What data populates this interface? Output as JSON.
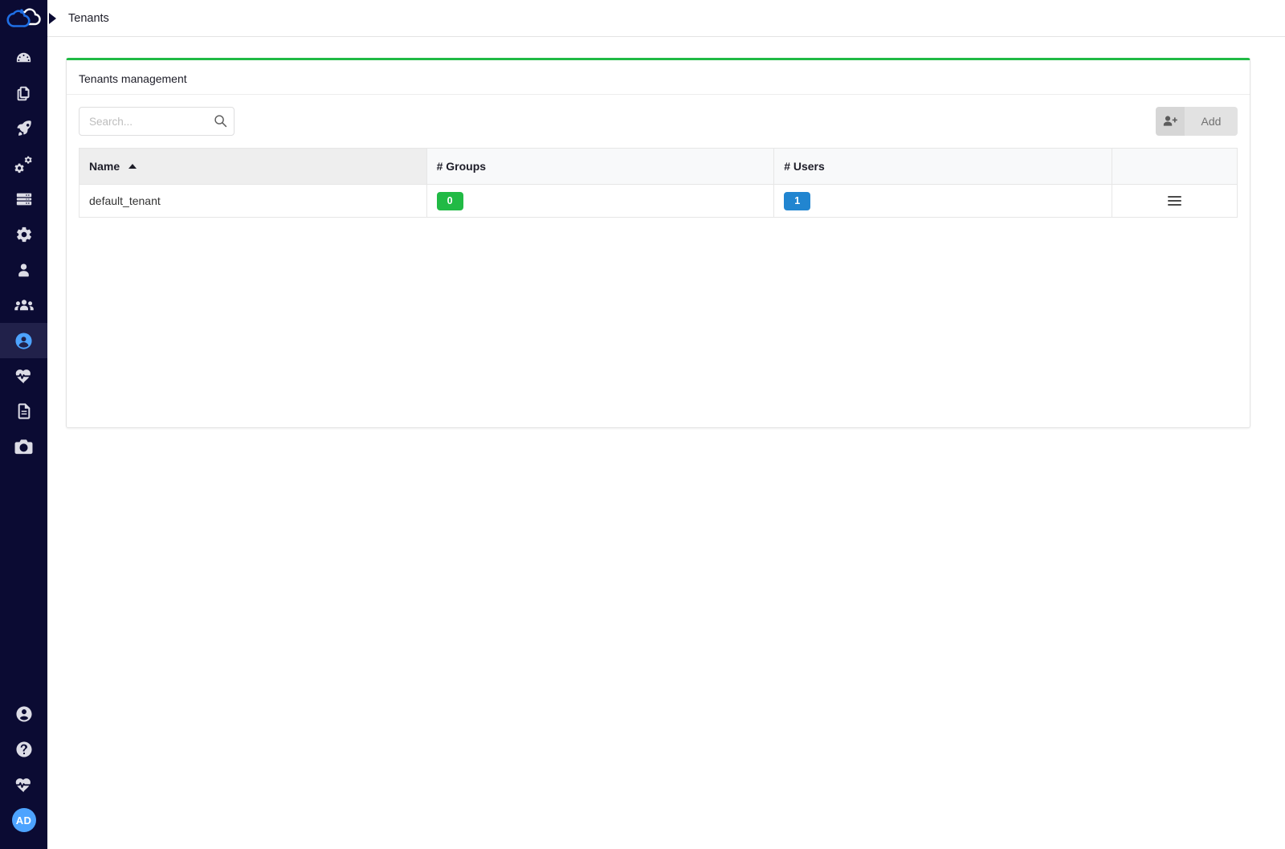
{
  "app": {
    "logo_name": "cloud-logo",
    "accent_green": "#21ba45",
    "accent_blue": "#2185d0",
    "sidebar_bg": "#0b0b33"
  },
  "topbar": {
    "breadcrumb": "Tenants"
  },
  "sidebar": {
    "top_items": [
      {
        "icon": "dashboard-gauge-icon",
        "name": "sidebar-item-dashboard",
        "active": false
      },
      {
        "icon": "blueprints-copy-icon",
        "name": "sidebar-item-blueprints",
        "active": false
      },
      {
        "icon": "deployments-rocket-icon",
        "name": "sidebar-item-deployments",
        "active": false
      },
      {
        "icon": "services-cogs-icon",
        "name": "sidebar-item-services",
        "active": false
      },
      {
        "icon": "nodes-server-icon",
        "name": "sidebar-item-nodes",
        "active": false
      },
      {
        "icon": "system-gear-icon",
        "name": "sidebar-item-system",
        "active": false
      },
      {
        "icon": "user-icon",
        "name": "sidebar-item-users",
        "active": false
      },
      {
        "icon": "user-group-icon",
        "name": "sidebar-item-user-groups",
        "active": false
      },
      {
        "icon": "tenant-user-circle-icon",
        "name": "sidebar-item-tenants",
        "active": true
      },
      {
        "icon": "heartbeat-icon",
        "name": "sidebar-item-health",
        "active": false
      },
      {
        "icon": "file-text-icon",
        "name": "sidebar-item-logs",
        "active": false
      },
      {
        "icon": "camera-icon",
        "name": "sidebar-item-snapshots",
        "active": false
      }
    ],
    "bottom_items": [
      {
        "icon": "user-circle-icon",
        "name": "sidebar-item-account",
        "active": false
      },
      {
        "icon": "question-circle-icon",
        "name": "sidebar-item-help",
        "active": false
      },
      {
        "icon": "heartbeat-icon",
        "name": "sidebar-item-status",
        "active": false
      }
    ],
    "avatar_initials": "AD"
  },
  "card": {
    "title": "Tenants management"
  },
  "search": {
    "value": "",
    "placeholder": "Search...",
    "icon": "search-icon"
  },
  "add_button": {
    "icon": "user-plus-icon",
    "label": "Add"
  },
  "table": {
    "columns": [
      {
        "label": "Name",
        "sorted": true,
        "sort_direction": "asc"
      },
      {
        "label": "# Groups",
        "sorted": false,
        "sort_direction": ""
      },
      {
        "label": "# Users",
        "sorted": false,
        "sort_direction": ""
      },
      {
        "label": "",
        "sorted": false,
        "sort_direction": ""
      }
    ],
    "rows": [
      {
        "name": "default_tenant",
        "groups": "0",
        "users": "1",
        "menu_icon": "hamburger-menu-icon"
      }
    ]
  }
}
